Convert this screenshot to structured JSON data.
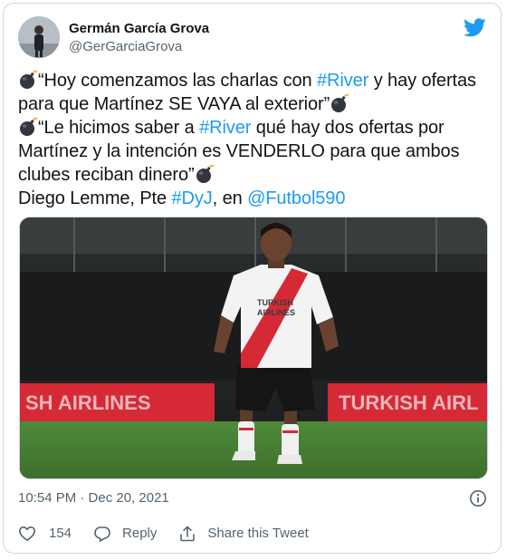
{
  "author": {
    "display_name": "Germán García Grova",
    "handle": "@GerGarciaGrova",
    "avatar_icon": "profile-photo",
    "logo_icon": "twitter-bird-icon"
  },
  "tweet": {
    "line1_quote": "“Hoy comenzamos las charlas con ",
    "line1_link": "#River",
    "line1_rest": " y hay ofertas",
    "line2_text": "para que Martínez SE VAYA al exterior”",
    "line3_quote": "“Le hicimos saber a ",
    "line3_link": "#River",
    "line3_rest": " qué hay dos ofertas por",
    "line4_text": "Martínez y la intención es VENDERLO para que ambos",
    "line5_text": "clubes reciban dinero”",
    "line6_text": "Diego Lemme, Pte ",
    "line6_link1": "#DyJ",
    "line6_mid": ", en ",
    "line6_link2": "@Futbol590",
    "emoji_icon": "bomb-emoji"
  },
  "media": {
    "jersey_text_1": "TURKISH",
    "jersey_text_2": "AIRLINES",
    "board_text_left": "SH AIRLINES",
    "board_text_right": "TURKISH AIRL"
  },
  "meta": {
    "timestamp": "10:54 PM · Dec 20, 2021",
    "info_icon": "info-icon"
  },
  "actions": {
    "like_count": "154",
    "reply_label": "Reply",
    "share_label": "Share this Tweet"
  },
  "colors": {
    "link": "#1d9bf0",
    "text": "#0f1419",
    "secondary": "#536471",
    "border": "#cfd9de"
  }
}
